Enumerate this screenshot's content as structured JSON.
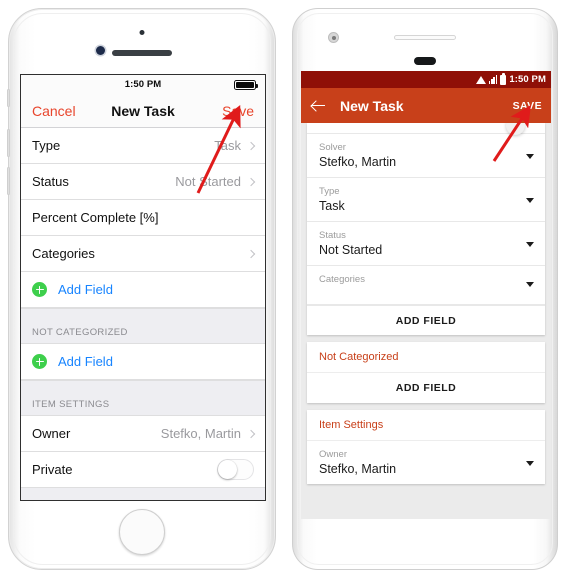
{
  "ios": {
    "status": {
      "time": "1:50 PM",
      "battery_icon": "battery-icon"
    },
    "nav": {
      "cancel": "Cancel",
      "title": "New Task",
      "save": "Save"
    },
    "rows": [
      {
        "label": "Type",
        "value": "Task",
        "chevron": true
      },
      {
        "label": "Status",
        "value": "Not Started",
        "chevron": true
      },
      {
        "label": "Percent Complete [%]",
        "value": "",
        "chevron": false
      },
      {
        "label": "Categories",
        "value": "",
        "chevron": true
      }
    ],
    "add_field_1": "Add Field",
    "section_not_categorized": "NOT CATEGORIZED",
    "add_field_2": "Add Field",
    "section_item_settings": "ITEM SETTINGS",
    "owner": {
      "label": "Owner",
      "value": "Stefko, Martin"
    },
    "private": {
      "label": "Private",
      "state": "off"
    }
  },
  "android": {
    "status": {
      "time": "1:50 PM",
      "wifi_icon": "wifi-icon",
      "signal_icon": "signal-icon",
      "battery_icon": "battery-icon"
    },
    "appbar": {
      "back_icon": "back-arrow-icon",
      "title": "New Task",
      "save": "SAVE"
    },
    "card1": {
      "fields": [
        {
          "label": "Solver",
          "value": "Stefko, Martin"
        },
        {
          "label": "Type",
          "value": "Task"
        },
        {
          "label": "Status",
          "value": "Not Started"
        },
        {
          "label": "Categories",
          "value": ""
        }
      ],
      "add_field": "ADD FIELD"
    },
    "card2": {
      "header": "Not Categorized",
      "add_field": "ADD FIELD"
    },
    "card3": {
      "header": "Item Settings",
      "fields": [
        {
          "label": "Owner",
          "value": "Stefko, Martin"
        }
      ]
    }
  },
  "annotations": {
    "arrow_left": {
      "name": "red-arrow-to-save-ios",
      "color": "#e01b1b"
    },
    "arrow_right": {
      "name": "red-arrow-to-save-android",
      "color": "#e01b1b"
    }
  },
  "colors": {
    "ios_accent": "#e8452c",
    "ios_link": "#1784ff",
    "ios_green": "#3ecf4c",
    "android_appbar": "#c8401a",
    "android_statusbar": "#8f1007",
    "arrow_red": "#e01b1b"
  }
}
